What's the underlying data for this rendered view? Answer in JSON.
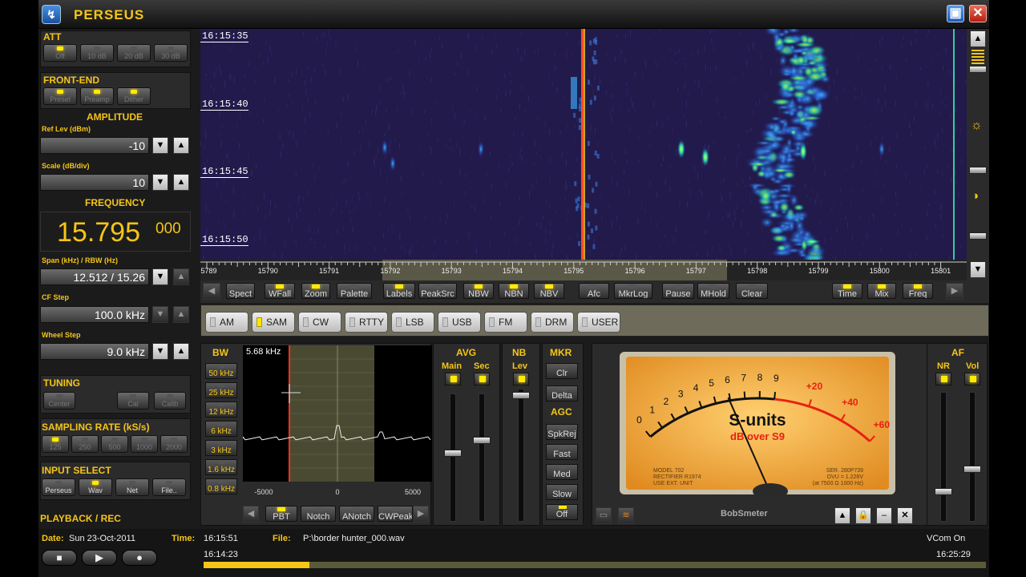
{
  "window": {
    "title": "PERSEUS",
    "minimize_glyph": "▣",
    "close_glyph": "✕"
  },
  "att": {
    "title": "ATT",
    "buttons": [
      "Off",
      "10 dB",
      "20 dB",
      "30 dB"
    ],
    "active": 0
  },
  "frontend": {
    "title": "FRONT-END",
    "buttons": [
      "Presel",
      "Preamp",
      "Dither"
    ],
    "active": [
      0,
      1,
      2
    ]
  },
  "amplitude": {
    "title": "AMPLITUDE",
    "ref_label": "Ref Lev (dBm)",
    "ref_value": "-10",
    "scale_label": "Scale (dB/div)",
    "scale_value": "10"
  },
  "frequency": {
    "title": "FREQUENCY",
    "main": "15.795",
    "sub": "000"
  },
  "span": {
    "label": "Span (kHz) / RBW (Hz)",
    "value": "12.512 / 15.26"
  },
  "cfstep": {
    "label": "CF Step",
    "value": "100.0 kHz"
  },
  "wheelstep": {
    "label": "Wheel Step",
    "value": "9.0 kHz"
  },
  "tuning": {
    "title": "TUNING",
    "buttons": [
      "Center",
      "Cal",
      "Calib"
    ]
  },
  "sampling": {
    "title": "SAMPLING RATE (kS/s)",
    "buttons": [
      "125",
      "250",
      "500",
      "1000",
      "2000"
    ],
    "active": 0
  },
  "input": {
    "title": "INPUT SELECT",
    "buttons": [
      "Perseus",
      "Wav",
      "Net",
      "File.."
    ],
    "active": 1
  },
  "playback": {
    "title": "PLAYBACK / REC"
  },
  "waterfall": {
    "times": [
      "16:15:35",
      "16:15:40",
      "16:15:45",
      "16:15:50"
    ],
    "freq_ticks": [
      "15789",
      "15790",
      "15791",
      "15792",
      "15793",
      "15794",
      "15795",
      "15796",
      "15797",
      "15798",
      "15799",
      "15800",
      "15801"
    ]
  },
  "toolbar": {
    "buttons": [
      {
        "label": "Spect",
        "on": false
      },
      {
        "label": "WFall",
        "on": true
      },
      {
        "label": "Zoom",
        "on": true
      },
      {
        "label": "Palette",
        "on": false
      },
      {
        "label": "Labels",
        "on": true
      },
      {
        "label": "PeakSrc",
        "on": false
      },
      {
        "label": "NBW",
        "on": true
      },
      {
        "label": "NBN",
        "on": true
      },
      {
        "label": "NBV",
        "on": true
      },
      {
        "label": "Afc",
        "on": false
      },
      {
        "label": "MkrLog",
        "on": false
      },
      {
        "label": "Pause",
        "on": false
      },
      {
        "label": "MHold",
        "on": false
      },
      {
        "label": "Clear",
        "on": false
      },
      {
        "label": "Time",
        "on": true
      },
      {
        "label": "Mix",
        "on": true
      },
      {
        "label": "Freq",
        "on": true
      }
    ],
    "left_arrow": "◀",
    "right_arrow": "▶"
  },
  "modes": {
    "items": [
      "AM",
      "SAM",
      "CW",
      "RTTY",
      "LSB",
      "USB",
      "FM",
      "DRM",
      "USER"
    ],
    "active": 1
  },
  "bw": {
    "title": "BW",
    "buttons": [
      "50 kHz",
      "25 kHz",
      "12 kHz",
      "6 kHz",
      "3 kHz",
      "1.6 kHz",
      "0.8 kHz"
    ],
    "readout": "5.68 kHz",
    "axis": [
      "-5000",
      "0",
      "5000"
    ]
  },
  "filter_bar": {
    "buttons": [
      "PBT",
      "Notch",
      "ANotch",
      "CWPeak"
    ],
    "left_arrow": "◀",
    "right_arrow": "▶"
  },
  "avg": {
    "title": "AVG",
    "main": "Main",
    "sec": "Sec"
  },
  "nb": {
    "title": "NB",
    "lev": "Lev"
  },
  "mkr": {
    "title": "MKR",
    "buttons": [
      "Clr",
      "Delta"
    ]
  },
  "agc": {
    "title": "AGC",
    "buttons": [
      "SpkRej",
      "Fast",
      "Med",
      "Slow",
      "Off"
    ]
  },
  "smeter": {
    "scale_left": [
      "0",
      "1",
      "2",
      "3",
      "4",
      "5",
      "6",
      "7",
      "8",
      "9"
    ],
    "scale_right": [
      "+20",
      "+40",
      "+60"
    ],
    "title": "S-units",
    "subtitle": "dB over S9",
    "small_left": "MODEL 702\nRECTIFIER R1974\nUSE EXT. UNIT",
    "small_right": "SER. 280P739\nOVU = 1.228V\n(at 7500 Ω 1000 Hz)",
    "name": "BobSmeter",
    "reading_s": 5.9
  },
  "af": {
    "title": "AF",
    "nr": "NR",
    "vol": "Vol"
  },
  "status": {
    "date_label": "Date:",
    "date": "Sun 23-Oct-2011",
    "time_label": "Time:",
    "time": "16:15:51",
    "file_label": "File:",
    "file": "P:\\border hunter_000.wav",
    "vcom": "VCom On",
    "start": "16:14:23",
    "end": "16:25:29",
    "progress": 0.135
  }
}
